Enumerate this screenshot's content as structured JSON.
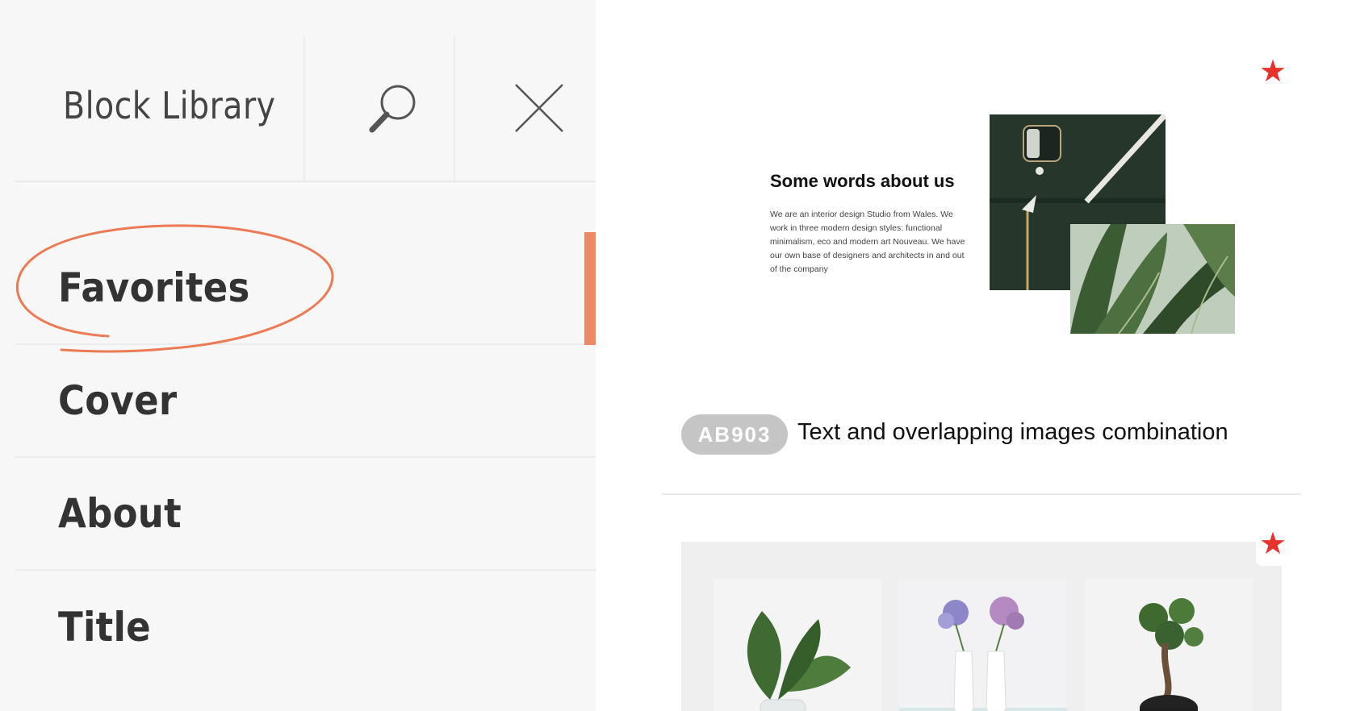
{
  "sidebar": {
    "title": "Block Library",
    "menu": [
      {
        "label": "Favorites",
        "active": true
      },
      {
        "label": "Cover",
        "active": false
      },
      {
        "label": "About",
        "active": false
      },
      {
        "label": "Title",
        "active": false
      }
    ]
  },
  "content": {
    "blocks": [
      {
        "code": "AB903",
        "title": "Text and overlapping images combination",
        "favorite": true,
        "preview": {
          "heading": "Some words about us",
          "text": "We are an interior design Studio from Wales. We work in three modern design styles: functional minimalism, eco and modern art Nouveau. We have our own base of designers and architects in and out of the company"
        }
      },
      {
        "favorite": true
      }
    ],
    "star_glyph": "★"
  },
  "colors": {
    "accent": "#ec8a68",
    "star": "#e8322c",
    "badge": "#c5c5c5",
    "sidebar_bg": "#f7f7f7"
  },
  "icons": {
    "search": "search-icon",
    "close": "close-icon",
    "favorite": "star-icon"
  }
}
